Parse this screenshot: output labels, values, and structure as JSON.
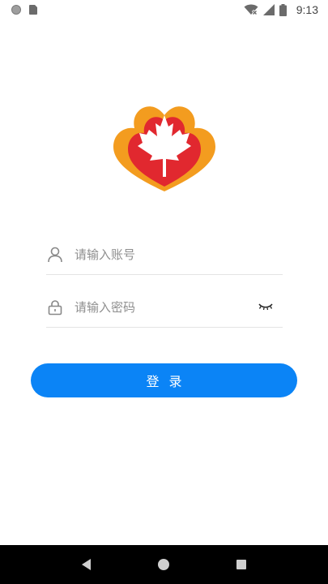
{
  "status_bar": {
    "time": "9:13",
    "icons": [
      "notification-dot-icon",
      "sim-card-icon",
      "wifi-off-icon",
      "signal-icon",
      "battery-icon"
    ]
  },
  "logo": {
    "icon": "maple-leaf-logo-icon",
    "colors": {
      "orange": "#f39c1f",
      "red": "#e1282f",
      "white": "#ffffff"
    }
  },
  "form": {
    "username": {
      "placeholder": "请输入账号",
      "value": "",
      "icon": "user-icon"
    },
    "password": {
      "placeholder": "请输入密码",
      "value": "",
      "icon": "lock-icon",
      "toggle_icon": "eye-closed-icon"
    }
  },
  "login_button": {
    "label": "登录",
    "color": "#0b84f6"
  },
  "nav_bar": {
    "buttons": [
      "back-icon",
      "home-icon",
      "recent-apps-icon"
    ]
  }
}
